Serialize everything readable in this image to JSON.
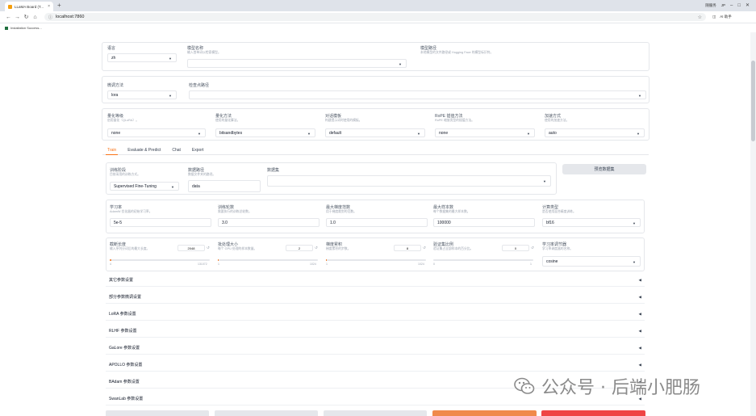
{
  "browser": {
    "tab_title": "LLaMA Board (T...",
    "tab_close": "×",
    "new_tab": "+",
    "right_labels": [
      "随服务",
      "JP"
    ],
    "url": "localhost:7860",
    "toolbar_right": [
      "AI 助手"
    ],
    "bookmark": "Installation Success..."
  },
  "top": {
    "lang_label": "语言",
    "lang_value": "zh",
    "model_name_label": "模型名称",
    "model_name_info": "输入首单词以检索模型。",
    "model_path_label": "模型路径",
    "model_path_info": "本地模型的文件路径或 Hugging Face 的模型标识符。",
    "finetune_label": "微调方法",
    "finetune_value": "lora",
    "ckpt_label": "检查点路径",
    "quant_bit_label": "量化等级",
    "quant_bit_info": "启用量化（QLoRA）。",
    "quant_bit_value": "none",
    "quant_method_label": "量化方法",
    "quant_method_info": "使用的量化算法。",
    "quant_method_value": "bitsandbytes",
    "template_label": "对话模板",
    "template_info": "构建提示词时使用的模板。",
    "template_value": "default",
    "rope_label": "RoPE 插值方法",
    "rope_info": "RoPE 缩放类型的插值方法。",
    "rope_value": "none",
    "booster_label": "加速方式",
    "booster_info": "使用的加速方法。",
    "booster_value": "auto"
  },
  "tabs": [
    "Train",
    "Evaluate & Predict",
    "Chat",
    "Export"
  ],
  "train": {
    "stage_label": "训练阶段",
    "stage_info": "目前采用的训练方式。",
    "stage_value": "Supervised Fine-Tuning",
    "dataset_dir_label": "数据路径",
    "dataset_dir_info": "数据文件夹的路径。",
    "dataset_dir_value": "data",
    "dataset_label": "数据集",
    "preview_button": "预览数据集",
    "lr_label": "学习率",
    "lr_info": "AdamW 优化器的初始学习率。",
    "lr_value": "5e-5",
    "epochs_label": "训练轮数",
    "epochs_info": "需要执行的训练总轮数。",
    "epochs_value": "3.0",
    "grad_norm_label": "最大梯度范数",
    "grad_norm_info": "用于梯度裁剪的范数。",
    "grad_norm_value": "1.0",
    "max_samples_label": "最大样本数",
    "max_samples_info": "每个数据集的最大样本数。",
    "max_samples_value": "100000",
    "compute_type_label": "计算类型",
    "compute_type_info": "是否使用混合精度训练。",
    "compute_type_value": "bf16",
    "cutoff_label": "截断长度",
    "cutoff_info": "输入序列分词后的最大长度。",
    "cutoff_value": "2048",
    "cutoff_min": "4",
    "cutoff_max": "131072",
    "cutoff_fraction": 0.016,
    "batch_label": "批处理大小",
    "batch_info": "每个 GPU 处理的样本数量。",
    "batch_value": "2",
    "batch_min": "1",
    "batch_max": "1024",
    "batch_fraction": 0.001,
    "grad_acc_label": "梯度累积",
    "grad_acc_info": "梯度累积的步数。",
    "grad_acc_value": "8",
    "grad_acc_min": "1",
    "grad_acc_max": "1024",
    "grad_acc_fraction": 0.007,
    "val_label": "验证集比例",
    "val_info": "验证集占全部样本的百分比。",
    "val_value": "0",
    "val_min": "0",
    "val_max": "1",
    "val_fraction": 0.0,
    "scheduler_label": "学习率调节器",
    "scheduler_info": "学习率调度器的名称。",
    "scheduler_value": "cosine",
    "reset_icon_text": "↺"
  },
  "accordions": [
    "其它参数设置",
    "部分参数微调设置",
    "LoRA 参数设置",
    "RLHF 参数设置",
    "GaLore 参数设置",
    "APOLLO 参数设置",
    "BAdam 参数设置",
    "SwanLab 参数设置"
  ],
  "watermark": {
    "text": "公众号 · 后端小肥肠"
  },
  "colors": {
    "accent": "#f97316",
    "bottom_buttons": [
      "#e5e7eb",
      "#e5e7eb",
      "#e5e7eb",
      "#f08a4b",
      "#ef4444"
    ]
  }
}
